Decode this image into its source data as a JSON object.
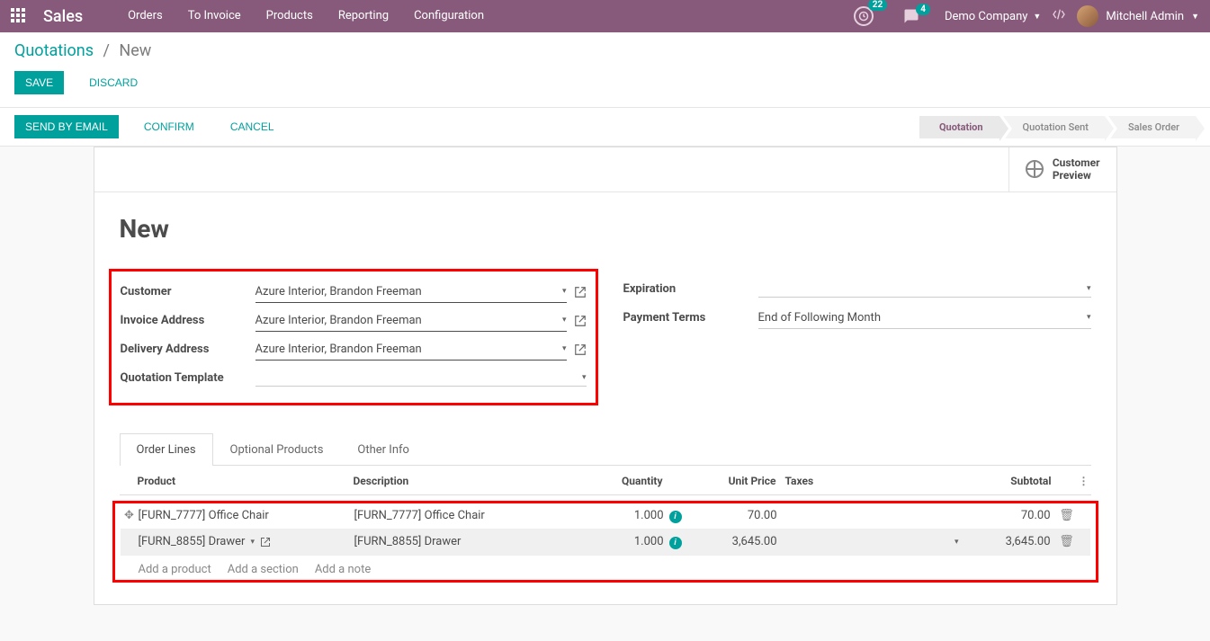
{
  "navbar": {
    "brand": "Sales",
    "menu": [
      "Orders",
      "To Invoice",
      "Products",
      "Reporting",
      "Configuration"
    ],
    "activity_count": "22",
    "chat_count": "4",
    "company": "Demo Company",
    "user": "Mitchell Admin"
  },
  "breadcrumb": {
    "root": "Quotations",
    "current": "New"
  },
  "actions": {
    "save": "Save",
    "discard": "Discard",
    "send_email": "Send by Email",
    "confirm": "Confirm",
    "cancel": "Cancel"
  },
  "status_steps": {
    "quotation": "Quotation",
    "quotation_sent": "Quotation Sent",
    "sales_order": "Sales Order"
  },
  "preview": {
    "line1": "Customer",
    "line2": "Preview"
  },
  "doc": {
    "title": "New"
  },
  "form": {
    "labels": {
      "customer": "Customer",
      "invoice_address": "Invoice Address",
      "delivery_address": "Delivery Address",
      "quotation_template": "Quotation Template",
      "expiration": "Expiration",
      "payment_terms": "Payment Terms"
    },
    "values": {
      "customer": "Azure Interior, Brandon Freeman",
      "invoice_address": "Azure Interior, Brandon Freeman",
      "delivery_address": "Azure Interior, Brandon Freeman",
      "quotation_template": "",
      "expiration": "",
      "payment_terms": "End of Following Month"
    }
  },
  "tabs": {
    "order_lines": "Order Lines",
    "optional_products": "Optional Products",
    "other_info": "Other Info"
  },
  "orderlines": {
    "headers": {
      "product": "Product",
      "description": "Description",
      "quantity": "Quantity",
      "unit_price": "Unit Price",
      "taxes": "Taxes",
      "subtotal": "Subtotal"
    },
    "rows": [
      {
        "product": "[FURN_7777] Office Chair",
        "description": "[FURN_7777] Office Chair",
        "qty": "1.000",
        "unit_price": "70.00",
        "taxes": "",
        "subtotal": "70.00"
      },
      {
        "product": "[FURN_8855] Drawer",
        "description": "[FURN_8855] Drawer",
        "qty": "1.000",
        "unit_price": "3,645.00",
        "taxes": "",
        "subtotal": "3,645.00"
      }
    ],
    "add_product": "Add a product",
    "add_section": "Add a section",
    "add_note": "Add a note"
  }
}
